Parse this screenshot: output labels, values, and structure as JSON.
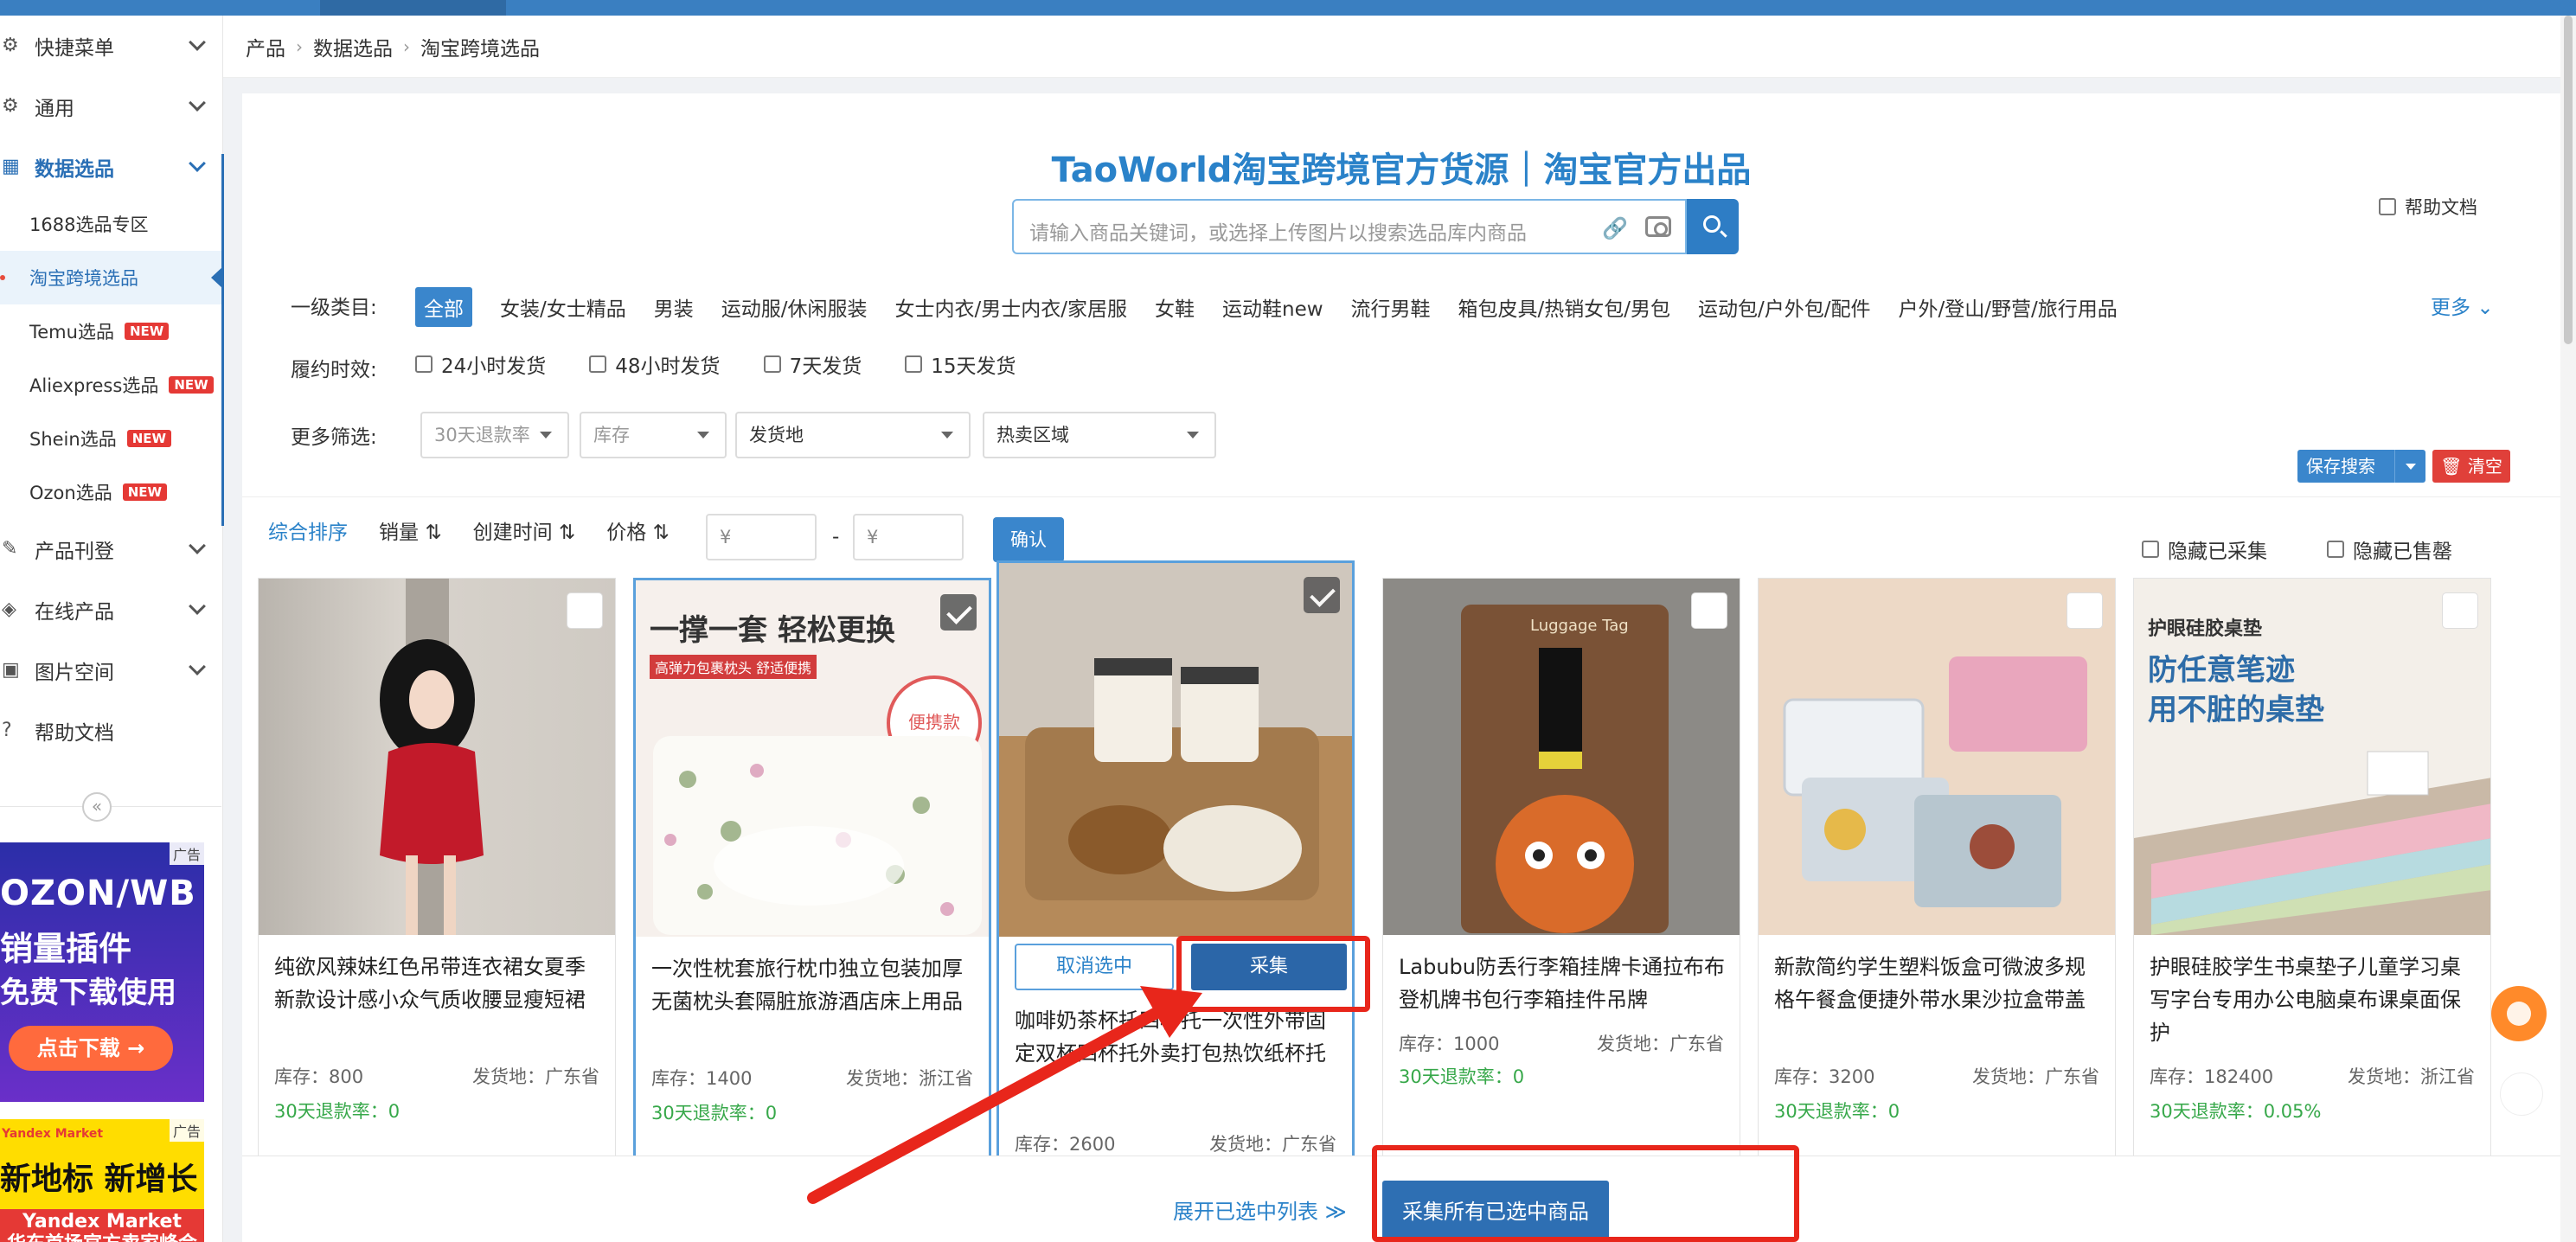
{
  "topbar": {
    "items": [
      "…",
      "…",
      "…",
      "…"
    ]
  },
  "sidebar": {
    "menu": [
      {
        "label": "快捷菜单"
      },
      {
        "label": "通用"
      },
      {
        "label": "数据选品"
      }
    ],
    "sub": [
      {
        "label": "1688选品专区"
      },
      {
        "label": "淘宝跨境选品"
      },
      {
        "label": "Temu选品",
        "badge": "NEW"
      },
      {
        "label": "Aliexpress选品",
        "badge": "NEW"
      },
      {
        "label": "Shein选品",
        "badge": "NEW"
      },
      {
        "label": "Ozon选品",
        "badge": "NEW"
      }
    ],
    "menu2": [
      {
        "label": "产品刊登"
      },
      {
        "label": "在线产品"
      },
      {
        "label": "图片空间"
      },
      {
        "label": "帮助文档"
      }
    ],
    "collapse": "«",
    "ad1": {
      "tag": "广告",
      "line1": "OZON/WB",
      "line2": "销量插件",
      "line3": "免费下载使用",
      "cta": "点击下载 →"
    },
    "ad2": {
      "tag": "广告",
      "brand": "Yandex Market",
      "line1": "新地标 新增长",
      "line2": "Yandex Market",
      "line3": "华东首场官方卖家峰会"
    }
  },
  "breadcrumb": [
    "产品",
    "数据选品",
    "淘宝跨境选品"
  ],
  "main": {
    "title": "TaoWorld淘宝跨境官方货源｜淘宝官方出品",
    "search_placeholder": "请输入商品关键词，或选择上传图片以搜索选品库内商品",
    "help_doc": "帮助文档",
    "cat_label": "一级类目:",
    "categories": [
      "全部",
      "女装/女士精品",
      "男装",
      "运动服/休闲服装",
      "女士内衣/男士内衣/家居服",
      "女鞋",
      "运动鞋new",
      "流行男鞋",
      "箱包皮具/热销女包/男包",
      "运动包/户外包/配件",
      "户外/登山/野营/旅行用品"
    ],
    "more": "更多",
    "fulfil_label": "履约时效:",
    "fulfil_opts": [
      "24小时发货",
      "48小时发货",
      "7天发货",
      "15天发货"
    ],
    "filter_label": "更多筛选:",
    "filters": {
      "refund": "30天退款率",
      "stock": "库存",
      "origin": "发货地",
      "hot": "热卖区域"
    },
    "save_search": "保存搜索",
    "clear": "清空",
    "sort": {
      "default": "综合排序",
      "sales": "销量",
      "created": "创建时间",
      "price": "价格"
    },
    "price_min": "¥",
    "price_max": "¥",
    "price_sep": "-",
    "confirm": "确认",
    "hide_collected": "隐藏已采集",
    "hide_soldout": "隐藏已售罄"
  },
  "products": [
    {
      "title": "纯欲风辣妹红色吊带连衣裙女夏季新款设计感小众气质收腰显瘦短裙",
      "stock": "库存：800",
      "ship": "发货地：广东省",
      "refund": "30天退款率：0",
      "checked": false
    },
    {
      "title": "一次性枕套旅行枕巾独立包装加厚无菌枕头套隔脏旅游酒店床上用品",
      "stock": "库存：1400",
      "ship": "发货地：浙江省",
      "refund": "30天退款率：0",
      "checked": true,
      "img_text1": "一撑一套 轻松更换",
      "img_text2": "高弹力包裹枕头 舒适便携",
      "img_text3": "便携款"
    },
    {
      "title": "咖啡奶茶杯托四杯托一次性外带固定双杯四杯托外卖打包热饮纸杯托",
      "stock": "库存：2600",
      "ship": "发货地：广东省",
      "refund": "",
      "checked": true,
      "cancel": "取消选中",
      "collect": "采集"
    },
    {
      "title": "Labubu防丢行李箱挂牌卡通拉布布登机牌书包行李箱挂件吊牌",
      "stock": "库存：1000",
      "ship": "发货地：广东省",
      "refund": "30天退款率：0",
      "checked": false,
      "img_text1": "Luggage Tag"
    },
    {
      "title": "新款简约学生塑料饭盒可微波多规格午餐盒便捷外带水果沙拉盒带盖",
      "stock": "库存：3200",
      "ship": "发货地：广东省",
      "refund": "30天退款率：0",
      "checked": false
    },
    {
      "title": "护眼硅胶学生书桌垫子儿童学习桌写字台专用办公电脑桌布课桌面保护",
      "stock": "库存：182400",
      "ship": "发货地：浙江省",
      "refund": "30天退款率：0.05%",
      "checked": false,
      "img_text1": "护眼硅胶桌垫",
      "img_text2": "防任意笔迹",
      "img_text3": "用不脏的桌垫"
    }
  ],
  "bottom": {
    "expand": "展开已选中列表 ≫",
    "collect_all": "采集所有已选中商品"
  },
  "colors": {
    "accent": "#2a82c9",
    "brand_blue": "#2e6fb3",
    "annotation_red": "#e8261b",
    "refund_green": "#37a84a"
  }
}
